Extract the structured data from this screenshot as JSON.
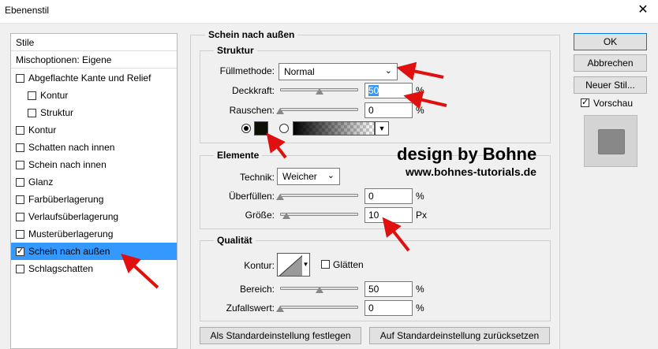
{
  "window": {
    "title": "Ebenenstil"
  },
  "styles_list": {
    "header": "Stile",
    "blend_options": "Mischoptionen: Eigene",
    "items": [
      {
        "label": "Abgeflachte Kante und Relief",
        "checked": false
      },
      {
        "label": "Kontur",
        "checked": false
      },
      {
        "label": "Struktur",
        "checked": false
      },
      {
        "label": "Kontur",
        "checked": false
      },
      {
        "label": "Schatten nach innen",
        "checked": false
      },
      {
        "label": "Schein nach innen",
        "checked": false
      },
      {
        "label": "Glanz",
        "checked": false
      },
      {
        "label": "Farbüberlagerung",
        "checked": false
      },
      {
        "label": "Verlaufsüberlagerung",
        "checked": false
      },
      {
        "label": "Musterüberlagerung",
        "checked": false
      },
      {
        "label": "Schein nach außen",
        "checked": true
      },
      {
        "label": "Schlagschatten",
        "checked": false
      }
    ]
  },
  "main": {
    "section_title": "Schein nach außen",
    "structure": {
      "title": "Struktur",
      "blend_mode_label": "Füllmethode:",
      "blend_mode_value": "Normal",
      "opacity_label": "Deckkraft:",
      "opacity_value": "50",
      "opacity_percent": 50,
      "noise_label": "Rauschen:",
      "noise_value": "0",
      "noise_percent": 0,
      "unit_percent": "%",
      "swatch_color": "#0d1004"
    },
    "elements": {
      "title": "Elemente",
      "technique_label": "Technik:",
      "technique_value": "Weicher",
      "spread_label": "Überfüllen:",
      "spread_value": "0",
      "spread_percent": 0,
      "size_label": "Größe:",
      "size_value": "10",
      "size_unit": "Px"
    },
    "quality": {
      "title": "Qualität",
      "contour_label": "Kontur:",
      "antialias_label": "Glätten",
      "range_label": "Bereich:",
      "range_value": "50",
      "range_percent": 50,
      "jitter_label": "Zufallswert:",
      "jitter_value": "0",
      "jitter_percent": 0
    },
    "buttons": {
      "make_default": "Als Standardeinstellung festlegen",
      "reset_default": "Auf Standardeinstellung zurücksetzen"
    }
  },
  "side": {
    "ok": "OK",
    "cancel": "Abbrechen",
    "new_style": "Neuer Stil...",
    "preview_label": "Vorschau",
    "preview_checked": true
  },
  "watermark": {
    "line1": "design by Bohne",
    "line2": "www.bohnes-tutorials.de"
  },
  "colors": {
    "selection": "#3399ff",
    "annotation_arrow": "#e01010"
  }
}
